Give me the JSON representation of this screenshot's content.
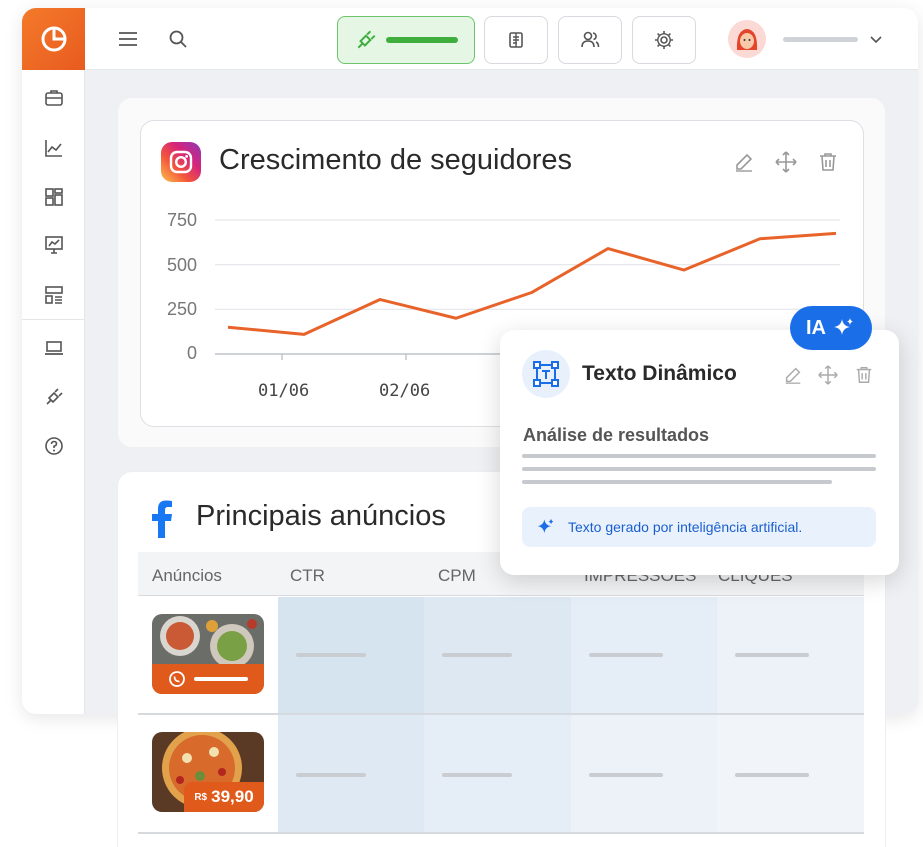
{
  "colors": {
    "accent": "#e8632a",
    "blue": "#1a6ee8",
    "green": "#3fae3f"
  },
  "sidebar": {
    "items": [
      {
        "icon": "briefcase-icon"
      },
      {
        "icon": "analytics-icon"
      },
      {
        "icon": "dashboard-icon"
      },
      {
        "icon": "presentation-icon"
      },
      {
        "icon": "layout-icon"
      },
      {
        "icon": "laptop-icon"
      },
      {
        "icon": "plug-icon"
      },
      {
        "icon": "help-icon"
      }
    ]
  },
  "chart_data": {
    "type": "line",
    "title": "Crescimento de seguidores",
    "yticks": [
      "750",
      "500",
      "250",
      "0"
    ],
    "ylim": [
      0,
      750
    ],
    "xlabels": [
      "01/06",
      "02/06"
    ],
    "series": [
      {
        "values": [
          150,
          110,
          305,
          200,
          345,
          590,
          470,
          645,
          675
        ]
      }
    ],
    "grid": true
  },
  "ai_card": {
    "badge": "IA",
    "title": "Texto Dinâmico",
    "subtitle": "Análise de resultados",
    "note": "Texto gerado por inteligência artificial."
  },
  "table": {
    "title": "Principais anúncios",
    "headers": [
      "Anúncios",
      "CTR",
      "CPM",
      "IMPRESSÕES",
      "CLIQUES"
    ],
    "rows": [
      {
        "thumb_label": ""
      },
      {
        "price_currency": "R$",
        "price_value": "39,90"
      }
    ]
  }
}
